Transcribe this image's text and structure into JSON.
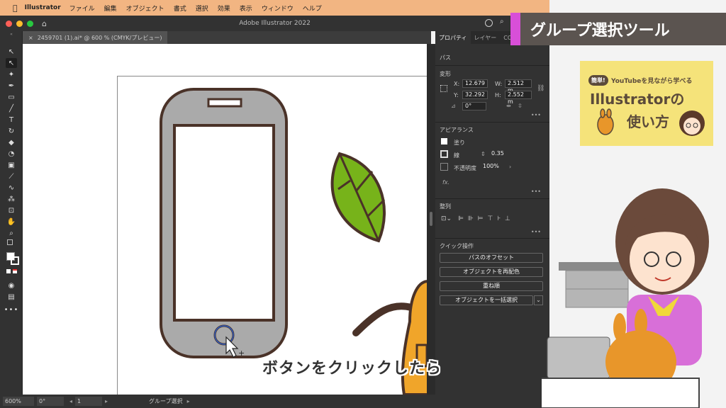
{
  "menubar": {
    "app_name": "Illustrator",
    "items": [
      "ファイル",
      "編集",
      "オブジェクト",
      "書式",
      "選択",
      "効果",
      "表示",
      "ウィンドウ",
      "ヘルプ"
    ]
  },
  "window": {
    "title": "Adobe Illustrator 2022"
  },
  "document_tab": {
    "close": "×",
    "name": "2459701 (1).ai* @ 600 % (CMYK/プレビュー)"
  },
  "panel": {
    "tabs": [
      "プロパティ",
      "レイヤー",
      "CC ラ"
    ],
    "object_type": "パス",
    "transform": {
      "heading": "変形",
      "x_label": "X:",
      "x_value": "12.679",
      "y_label": "Y:",
      "y_value": "32.292",
      "w_label": "W:",
      "w_value": "2.512 m",
      "h_label": "H:",
      "h_value": "2.552 m",
      "angle_value": "0°"
    },
    "appearance": {
      "heading": "アピアランス",
      "fill_label": "塗り",
      "stroke_label": "線",
      "stroke_value": "0.35",
      "opacity_label": "不透明度",
      "opacity_value": "100%",
      "fx_label": "fx."
    },
    "align": {
      "heading": "整列"
    },
    "quick_actions": {
      "heading": "クイック操作",
      "buttons": [
        "パスのオフセット",
        "オブジェクトを再配色",
        "重ね順",
        "オブジェクトを一括選択"
      ]
    }
  },
  "statusbar": {
    "zoom": "600%",
    "angle": "0°",
    "artboard": "1",
    "tool": "グループ選択"
  },
  "overlay": {
    "banner": "グループ選択ツール",
    "badge_tag": "簡単!",
    "badge_line1": "YouTubeを見ながら学べる",
    "badge_title": "Illustratorの",
    "badge_title2": "使い方",
    "caption": "ボタンをクリックしたら"
  },
  "colors": {
    "menubar": "#f2b582",
    "banner": "#5b5450",
    "banner_accent": "#d84fd8",
    "badge": "#f5e37a",
    "phone_body": "#aaaaaa",
    "outline": "#4a3228",
    "leaf": "#77b31a",
    "orange": "#f0a52a"
  }
}
